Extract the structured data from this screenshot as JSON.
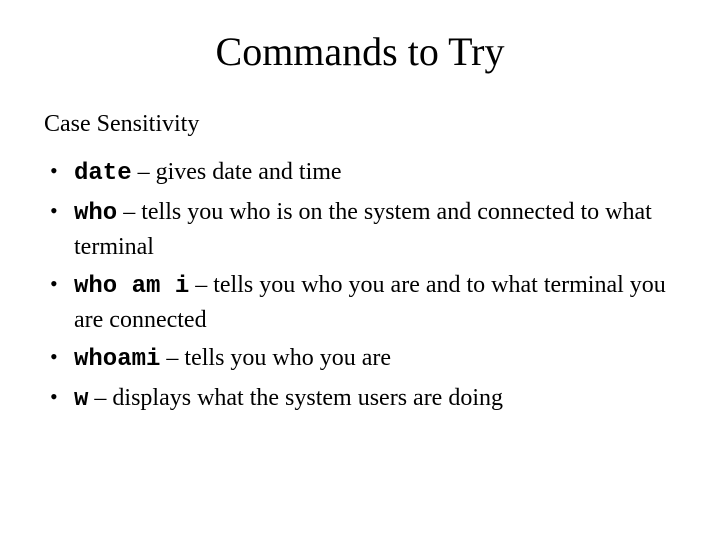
{
  "title": "Commands to Try",
  "subtitle": "Case Sensitivity",
  "bullets": [
    {
      "cmd": "date",
      "sep": " – ",
      "desc": "gives date and time"
    },
    {
      "cmd": "who",
      "sep": " – ",
      "desc": "tells you who is on the system and connected to what terminal"
    },
    {
      "cmd": "who am i",
      "sep": " – ",
      "desc": "tells you who you are and to what terminal you are connected"
    },
    {
      "cmd": "whoami",
      "sep": " – ",
      "desc": "tells you who you are"
    },
    {
      "cmd": "w",
      "sep": " – ",
      "desc": "displays what the system users are doing"
    }
  ]
}
